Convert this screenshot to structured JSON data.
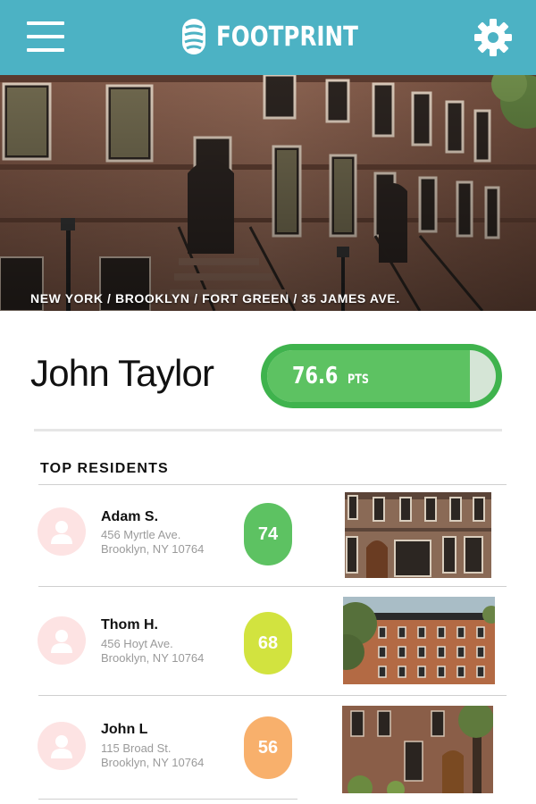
{
  "header": {
    "menu_icon": "hamburger-menu-icon",
    "logo_icon": "footprint-logo-icon",
    "app_name": "FOOTPRINT",
    "settings_icon": "gear-icon",
    "background_color": "#4cb2c4"
  },
  "hero": {
    "breadcrumb": "NEW YORK / BROOKLYN / FORT GREEN / 35 JAMES AVE."
  },
  "profile": {
    "name": "John Taylor",
    "score_value": "76.6",
    "score_unit": "PTS",
    "score_fraction": 0.766,
    "score_color": "#5dc262"
  },
  "top_residents": {
    "title": "TOP RESIDENTS",
    "avatar_icon": "user-icon",
    "items": [
      {
        "name": "Adam S.",
        "street": "456 Myrtle Ave.",
        "city": "Brooklyn, NY 10764",
        "score": "74",
        "badge_color": "#5dc262"
      },
      {
        "name": "Thom H.",
        "street": "456 Hoyt Ave.",
        "city": "Brooklyn, NY 10764",
        "score": "68",
        "badge_color": "#d2e33f"
      },
      {
        "name": "John L",
        "street": "115 Broad St.",
        "city": "Brooklyn, NY 10764",
        "score": "56",
        "badge_color": "#f8b06c"
      }
    ]
  }
}
